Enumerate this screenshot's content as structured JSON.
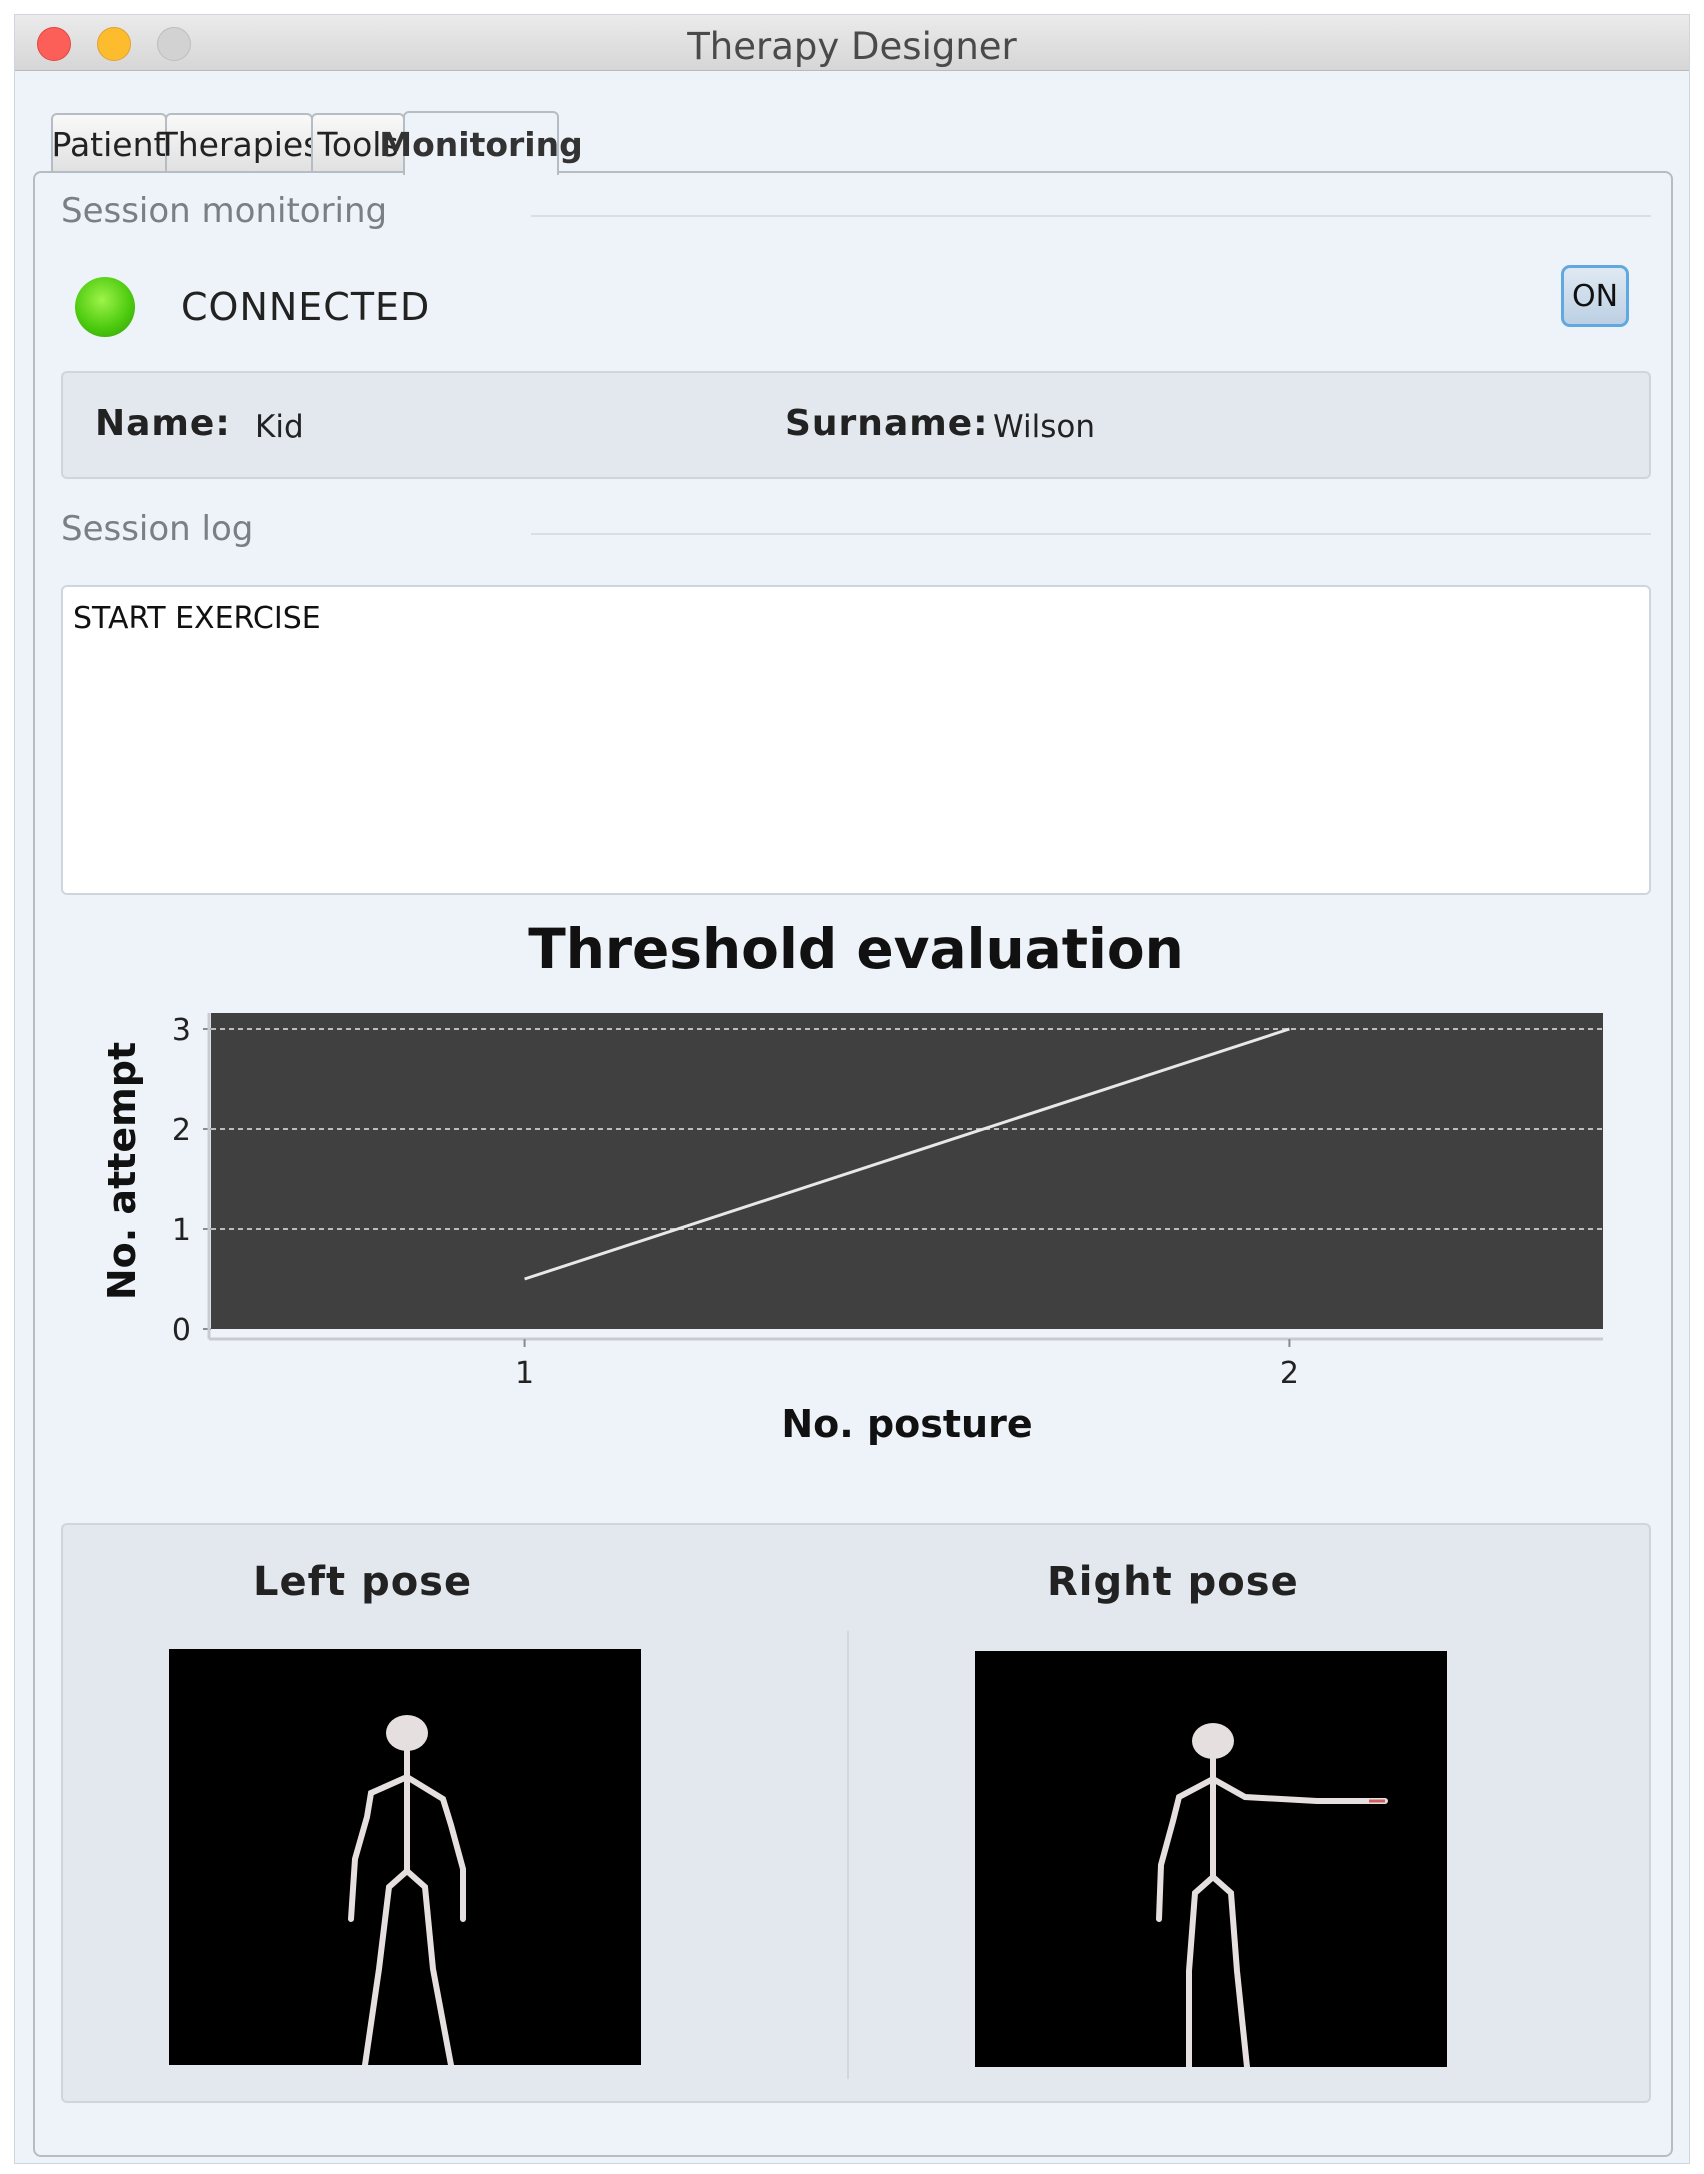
{
  "window": {
    "title": "Therapy Designer"
  },
  "tabs": [
    {
      "label": "Patient",
      "active": false
    },
    {
      "label": "Therapies",
      "active": false
    },
    {
      "label": "Tools",
      "active": false
    },
    {
      "label": "Monitoring",
      "active": true
    }
  ],
  "session": {
    "section_label": "Session monitoring",
    "status_text": "CONNECTED",
    "status_color": "#4fcc10",
    "toggle_label": "ON"
  },
  "patient": {
    "name_label": "Name:",
    "name_value": "Kid",
    "surname_label": "Surname:",
    "surname_value": "Wilson"
  },
  "log": {
    "section_label": "Session log",
    "text": "START EXERCISE"
  },
  "chart_data": {
    "type": "line",
    "title": "Threshold evaluation",
    "xlabel": "No. posture",
    "ylabel": "No. attempt",
    "x_ticks": [
      "1",
      "2"
    ],
    "y_ticks": [
      "0",
      "1",
      "2",
      "3"
    ],
    "xlim": [
      0.59,
      2.41
    ],
    "ylim": [
      0,
      3.16
    ],
    "grid": true,
    "background": "#404040",
    "line_color": "#e8e8e8",
    "series": [
      {
        "x": [
          1,
          2
        ],
        "y": [
          0.5,
          3
        ]
      }
    ]
  },
  "poses": {
    "left_title": "Left pose",
    "right_title": "Right pose"
  }
}
